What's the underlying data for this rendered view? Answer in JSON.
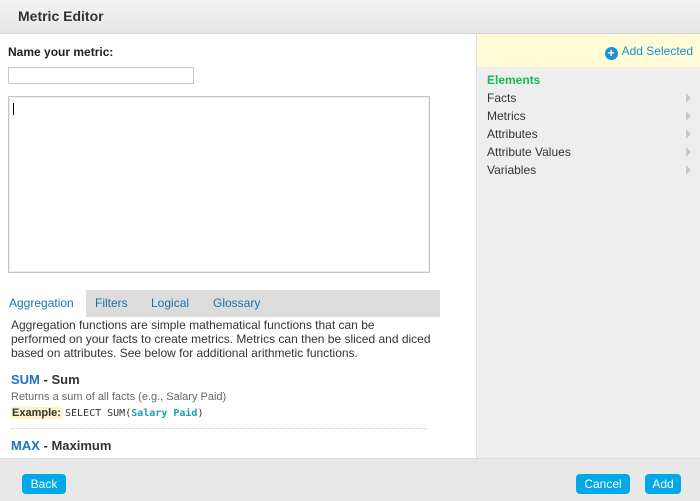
{
  "window": {
    "title": "Metric Editor"
  },
  "form": {
    "name_label": "Name your metric:",
    "name_value": "",
    "editor_value": ""
  },
  "tabs": [
    {
      "label": "Aggregation",
      "active": true
    },
    {
      "label": "Filters",
      "active": false
    },
    {
      "label": "Logical",
      "active": false
    },
    {
      "label": "Glossary",
      "active": false
    }
  ],
  "aggregation": {
    "description": "Aggregation functions are simple mathematical functions that can be performed on your facts to create metrics. Metrics can then be sliced and diced based on attributes. See below for additional arithmetic functions.",
    "functions": [
      {
        "code": "SUM",
        "separator": " - ",
        "name": "Sum",
        "description": "Returns a sum of all facts (e.g., Salary Paid)",
        "example_label": "Example:",
        "example_code_prefix": "SELECT SUM(",
        "example_arg": "Salary Paid",
        "example_code_suffix": ")"
      },
      {
        "code": "MAX",
        "separator": " - ",
        "name": "Maximum"
      }
    ]
  },
  "sidebar": {
    "add_selected_label": "Add Selected",
    "heading": "Elements",
    "items": [
      "Facts",
      "Metrics",
      "Attributes",
      "Attribute Values",
      "Variables"
    ]
  },
  "footer": {
    "back_label": "Back",
    "cancel_label": "Cancel",
    "add_label": "Add"
  },
  "colors": {
    "accent": "#00a8e8",
    "elements_heading": "#19b85a",
    "link": "#1a73c8"
  }
}
